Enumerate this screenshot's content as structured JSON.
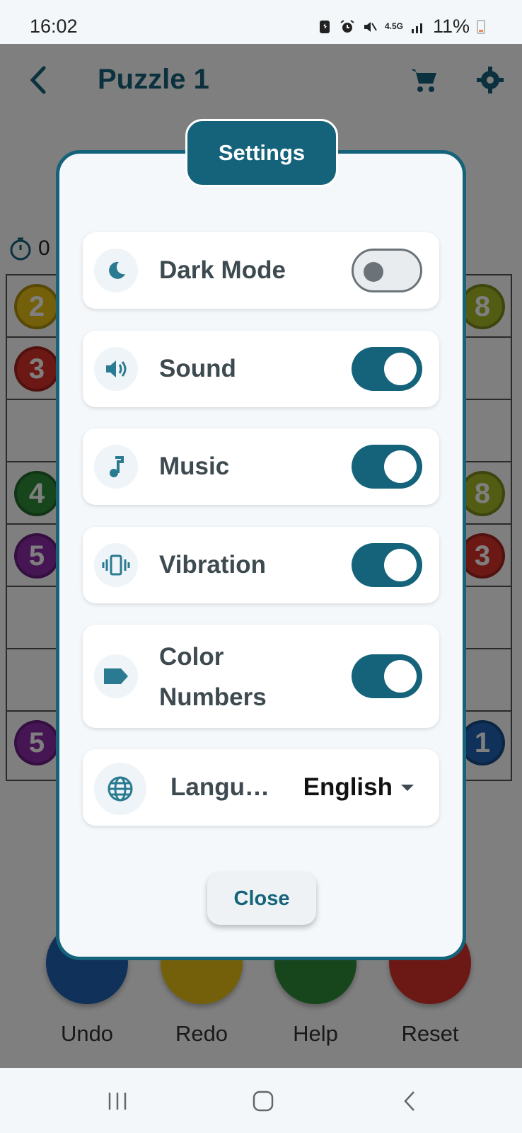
{
  "status_bar": {
    "time": "16:02",
    "network": "4.5G",
    "battery": "11%"
  },
  "app": {
    "title": "Puzzle 1",
    "timer": "0",
    "grid_left_balls": [
      "2",
      "3",
      "4",
      "5",
      "5"
    ],
    "grid_right_balls": [
      "8",
      "8",
      "3",
      "1"
    ],
    "actions": [
      {
        "label": "Undo",
        "color": "#1e63b5"
      },
      {
        "label": "Redo",
        "color": "#e8c016"
      },
      {
        "label": "Help",
        "color": "#2e8c39"
      },
      {
        "label": "Reset",
        "color": "#d8322a"
      }
    ]
  },
  "dialog": {
    "header": "Settings",
    "rows": [
      {
        "label": "Dark Mode",
        "icon": "moon-icon",
        "state": "off"
      },
      {
        "label": "Sound",
        "icon": "speaker-icon",
        "state": "on"
      },
      {
        "label": "Music",
        "icon": "music-note-icon",
        "state": "on"
      },
      {
        "label": "Vibration",
        "icon": "vibration-icon",
        "state": "on"
      },
      {
        "label_line1": "Color",
        "label_line2": "Numbers",
        "icon": "label-tag-icon",
        "state": "on"
      }
    ],
    "language": {
      "label": "Langu…",
      "value": "English",
      "icon": "globe-icon"
    },
    "close_label": "Close"
  },
  "colors": {
    "accent": "#15637a",
    "toggle_off": "#6b7378",
    "card_bg": "#ffffff",
    "dialog_bg": "#f4f8fb"
  }
}
